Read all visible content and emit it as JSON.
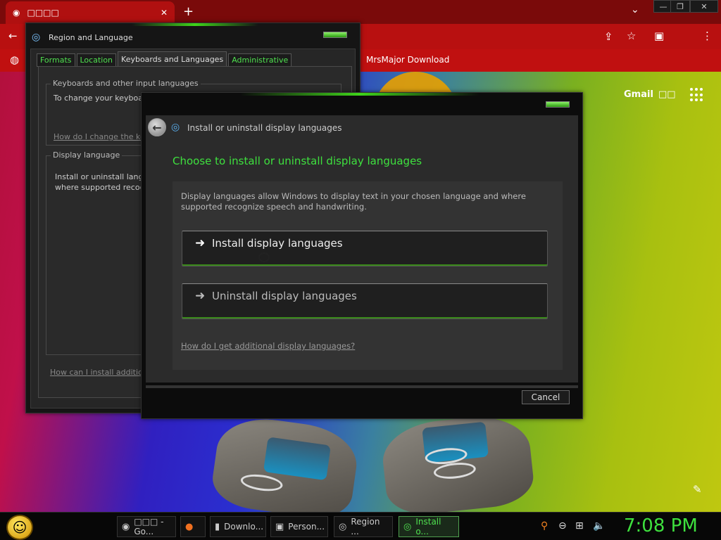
{
  "browser": {
    "tab_title": "□□□□",
    "tab_close": "✕",
    "new_tab": "+",
    "tab_overflow": "⌄",
    "window_controls": {
      "minimize": "—",
      "restore": "❐",
      "close": "✕"
    },
    "bookmark": "MrsMajor Download",
    "gmail": "Gmail",
    "images": "□□",
    "avatar": "●",
    "colors": {
      "titlebar": "#7a0a0a",
      "toolbar": "#b81010"
    }
  },
  "region_window": {
    "title": "Region and Language",
    "tabs": [
      {
        "label": "Formats"
      },
      {
        "label": "Location"
      },
      {
        "label": "Keyboards and Languages"
      },
      {
        "label": "Administrative"
      }
    ],
    "keyboards_group": {
      "legend": "Keyboards and other input languages",
      "text": "To change your keyboa",
      "link": "How do I change the ke"
    },
    "display_group": {
      "legend": "Display language",
      "text1": "Install or uninstall lang",
      "text2": "where supported recog"
    },
    "footer_link": "How can I install addition"
  },
  "install_dialog": {
    "nav_title": "Install or uninstall display languages",
    "heading": "Choose to install or uninstall display languages",
    "description": "Display languages allow Windows to display text in your chosen language and where supported recognize speech and handwriting.",
    "install_label": "Install display languages",
    "uninstall_label": "Uninstall display languages",
    "help_link": "How do I get additional display languages?",
    "cancel_label": "Cancel",
    "accent": "#3ee03e"
  },
  "taskbar": {
    "items": [
      {
        "label": "□□□ - Go...",
        "icon": "chrome-icon"
      },
      {
        "label": "",
        "icon": "firefox-icon"
      },
      {
        "label": "Downlo...",
        "icon": "downloads-icon"
      },
      {
        "label": "Person...",
        "icon": "personalize-icon"
      },
      {
        "label": "Region ...",
        "icon": "region-icon"
      },
      {
        "label": "Install o...",
        "icon": "install-icon"
      }
    ],
    "clock": "7:08 PM"
  }
}
